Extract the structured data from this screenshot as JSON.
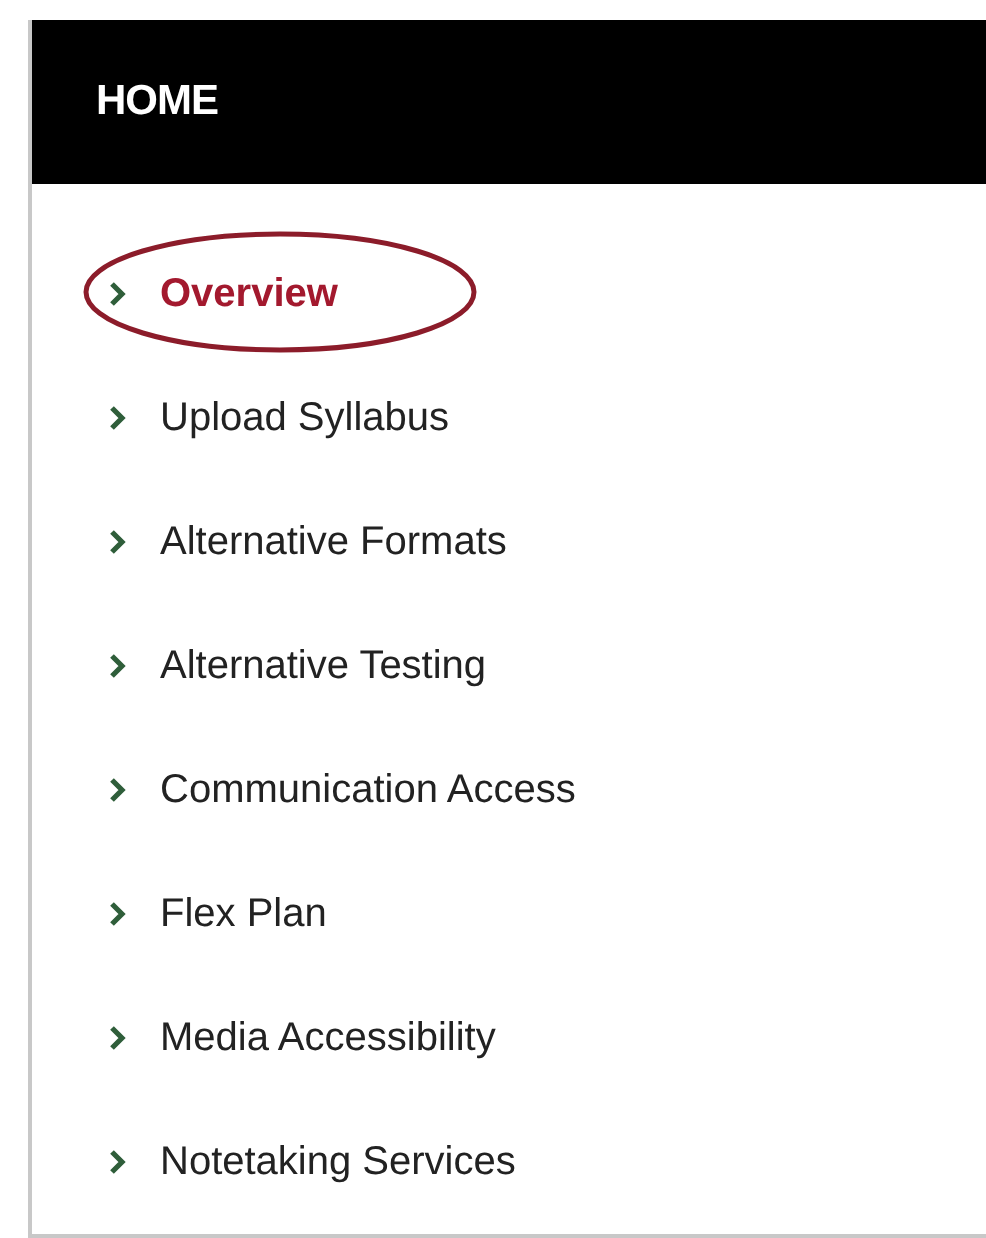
{
  "header": {
    "title": "HOME"
  },
  "items": [
    {
      "label": "Overview",
      "selected": true
    },
    {
      "label": "Upload Syllabus",
      "selected": false
    },
    {
      "label": "Alternative Formats",
      "selected": false
    },
    {
      "label": "Alternative Testing",
      "selected": false
    },
    {
      "label": "Communication Access",
      "selected": false
    },
    {
      "label": "Flex Plan",
      "selected": false
    },
    {
      "label": "Media Accessibility",
      "selected": false
    },
    {
      "label": "Notetaking Services",
      "selected": false
    }
  ]
}
